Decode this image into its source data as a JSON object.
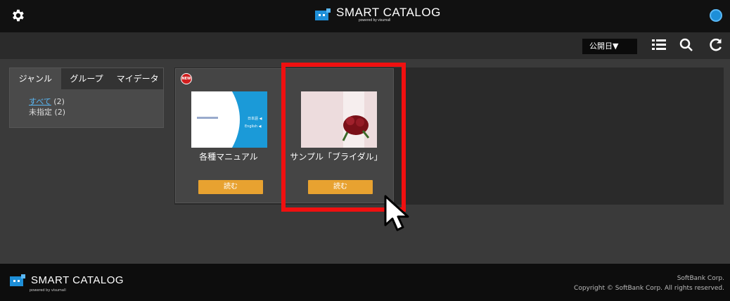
{
  "header": {
    "logo_text": "SMART CATALOG",
    "logo_sub": "powered by visumall"
  },
  "toolbar": {
    "sort_label": "公開日▼"
  },
  "sidebar": {
    "tabs": [
      {
        "label": "ジャンル"
      },
      {
        "label": "グループ"
      },
      {
        "label": "マイデータ"
      }
    ],
    "filters": [
      {
        "label": "すべて",
        "count": "(2)"
      },
      {
        "label": "未指定",
        "count": "(2)"
      }
    ]
  },
  "catalogs": [
    {
      "badge": "NEW",
      "title": "各種マニュアル",
      "read_label": "読む"
    },
    {
      "title": "サンプル「ブライダル」",
      "read_label": "読む"
    }
  ],
  "thumb1": {
    "lang1": "日本語 ◀",
    "lang2": "English ◀"
  },
  "footer": {
    "logo_text": "SMART CATALOG",
    "logo_sub": "powered by visumall",
    "company": "SoftBank Corp.",
    "copyright": "Copyright © SoftBank Corp. All rights reserved."
  }
}
